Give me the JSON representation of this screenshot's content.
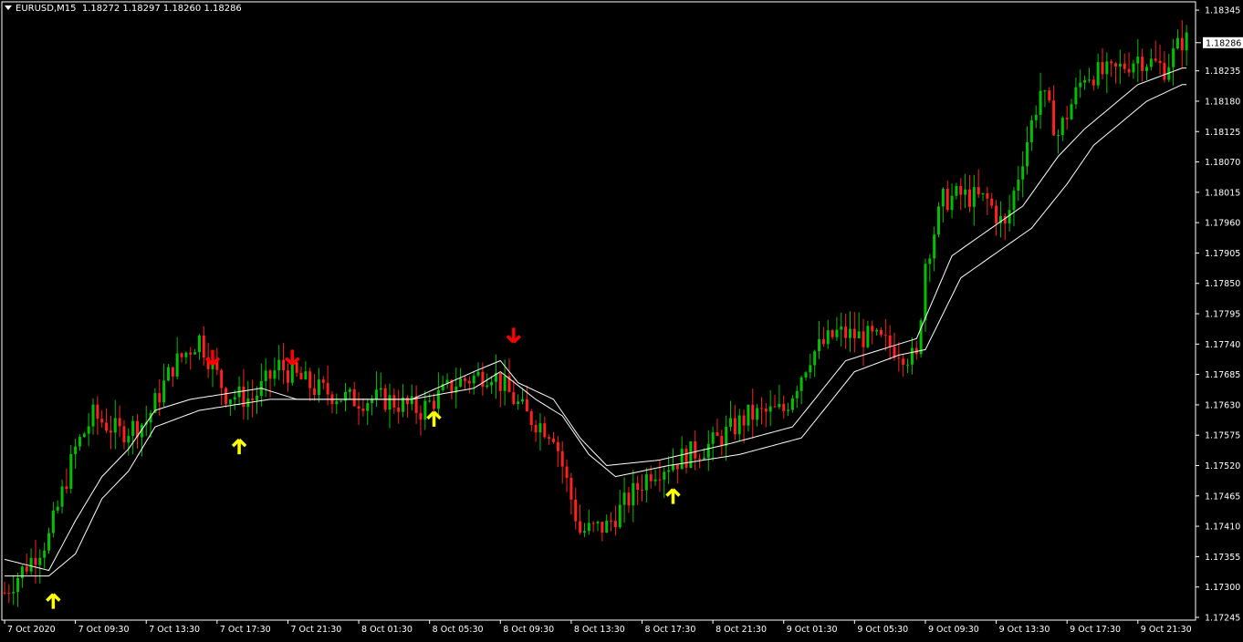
{
  "header": {
    "symbol": "EURUSD,M15",
    "ohlc": "1.18272 1.18297 1.18260 1.18286"
  },
  "colors": {
    "background": "#000000",
    "bull": "#00c000",
    "bear": "#ff2020",
    "band": "#ffffff",
    "buy_arrow": "#ffff00",
    "sell_arrow": "#ff0000",
    "axis": "#ffffff"
  },
  "chart_data": {
    "type": "candlestick",
    "title": "EURUSD,M15",
    "ylim": [
      1.1724,
      1.1836
    ],
    "y_ticks": [
      "1.18345",
      "1.18235",
      "1.18180",
      "1.18125",
      "1.18070",
      "1.18015",
      "1.17960",
      "1.17905",
      "1.17850",
      "1.17795",
      "1.17740",
      "1.17685",
      "1.17630",
      "1.17575",
      "1.17520",
      "1.17465",
      "1.17410",
      "1.17355",
      "1.17300",
      "1.17245"
    ],
    "current_price": "1.18286",
    "x_ticks": [
      "7 Oct 2020",
      "7 Oct 09:30",
      "7 Oct 13:30",
      "7 Oct 17:30",
      "7 Oct 21:30",
      "8 Oct 01:30",
      "8 Oct 05:30",
      "8 Oct 09:30",
      "8 Oct 13:30",
      "8 Oct 17:30",
      "8 Oct 21:30",
      "9 Oct 01:30",
      "9 Oct 05:30",
      "9 Oct 09:30",
      "9 Oct 13:30",
      "9 Oct 17:30",
      "9 Oct 21:30"
    ],
    "price_path": [
      [
        0,
        1.1729
      ],
      [
        10,
        1.1739
      ],
      [
        16,
        1.1755
      ],
      [
        20,
        1.1761
      ],
      [
        26,
        1.1758
      ],
      [
        32,
        1.176
      ],
      [
        38,
        1.177
      ],
      [
        44,
        1.1775
      ],
      [
        50,
        1.1765
      ],
      [
        56,
        1.1764
      ],
      [
        62,
        1.177
      ],
      [
        70,
        1.1766
      ],
      [
        78,
        1.1764
      ],
      [
        86,
        1.1764
      ],
      [
        94,
        1.1762
      ],
      [
        102,
        1.1767
      ],
      [
        110,
        1.1769
      ],
      [
        118,
        1.1761
      ],
      [
        124,
        1.1758
      ],
      [
        130,
        1.174
      ],
      [
        136,
        1.1741
      ],
      [
        140,
        1.1745
      ],
      [
        146,
        1.1751
      ],
      [
        152,
        1.1753
      ],
      [
        160,
        1.1756
      ],
      [
        168,
        1.1761
      ],
      [
        176,
        1.1762
      ],
      [
        182,
        1.1772
      ],
      [
        188,
        1.1776
      ],
      [
        196,
        1.1775
      ],
      [
        202,
        1.1773
      ],
      [
        206,
        1.1771
      ],
      [
        208,
        1.1789
      ],
      [
        212,
        1.18
      ],
      [
        216,
        1.1801
      ],
      [
        222,
        1.18
      ],
      [
        226,
        1.1795
      ],
      [
        230,
        1.1808
      ],
      [
        234,
        1.182
      ],
      [
        238,
        1.1812
      ],
      [
        244,
        1.1823
      ],
      [
        250,
        1.1823
      ],
      [
        256,
        1.1826
      ],
      [
        262,
        1.1824
      ],
      [
        266,
        1.1829
      ]
    ],
    "upper_band": [
      [
        0,
        1.1735
      ],
      [
        10,
        1.1733
      ],
      [
        16,
        1.1742
      ],
      [
        22,
        1.175
      ],
      [
        28,
        1.1755
      ],
      [
        34,
        1.1762
      ],
      [
        42,
        1.1764
      ],
      [
        58,
        1.1766
      ],
      [
        66,
        1.1764
      ],
      [
        80,
        1.1764
      ],
      [
        92,
        1.1764
      ],
      [
        106,
        1.1769
      ],
      [
        112,
        1.1771
      ],
      [
        116,
        1.1767
      ],
      [
        124,
        1.1764
      ],
      [
        130,
        1.1757
      ],
      [
        136,
        1.1752
      ],
      [
        148,
        1.1753
      ],
      [
        164,
        1.1756
      ],
      [
        178,
        1.1759
      ],
      [
        190,
        1.1771
      ],
      [
        202,
        1.1774
      ],
      [
        206,
        1.1775
      ],
      [
        214,
        1.179
      ],
      [
        230,
        1.1799
      ],
      [
        238,
        1.1808
      ],
      [
        244,
        1.1813
      ],
      [
        256,
        1.1821
      ],
      [
        266,
        1.1824
      ]
    ],
    "lower_band": [
      [
        0,
        1.1732
      ],
      [
        10,
        1.1732
      ],
      [
        16,
        1.1736
      ],
      [
        22,
        1.1746
      ],
      [
        28,
        1.1751
      ],
      [
        34,
        1.1759
      ],
      [
        44,
        1.1762
      ],
      [
        60,
        1.1764
      ],
      [
        68,
        1.1764
      ],
      [
        92,
        1.1764
      ],
      [
        106,
        1.1766
      ],
      [
        112,
        1.1769
      ],
      [
        120,
        1.1764
      ],
      [
        126,
        1.1761
      ],
      [
        132,
        1.1754
      ],
      [
        138,
        1.175
      ],
      [
        150,
        1.1752
      ],
      [
        166,
        1.1754
      ],
      [
        180,
        1.1757
      ],
      [
        192,
        1.1769
      ],
      [
        202,
        1.1772
      ],
      [
        208,
        1.1773
      ],
      [
        216,
        1.1786
      ],
      [
        232,
        1.1795
      ],
      [
        240,
        1.1803
      ],
      [
        246,
        1.181
      ],
      [
        258,
        1.1818
      ],
      [
        266,
        1.1821
      ]
    ],
    "signals": [
      {
        "type": "buy",
        "bar": 11,
        "price": 1.1731
      },
      {
        "type": "sell",
        "bar": 47,
        "price": 1.1768
      },
      {
        "type": "buy",
        "bar": 53,
        "price": 1.1759
      },
      {
        "type": "sell",
        "bar": 65,
        "price": 1.1768
      },
      {
        "type": "buy",
        "bar": 97,
        "price": 1.1764
      },
      {
        "type": "sell",
        "bar": 115,
        "price": 1.1772
      },
      {
        "type": "buy",
        "bar": 151,
        "price": 1.175
      }
    ],
    "grid": false,
    "legend": "none"
  }
}
